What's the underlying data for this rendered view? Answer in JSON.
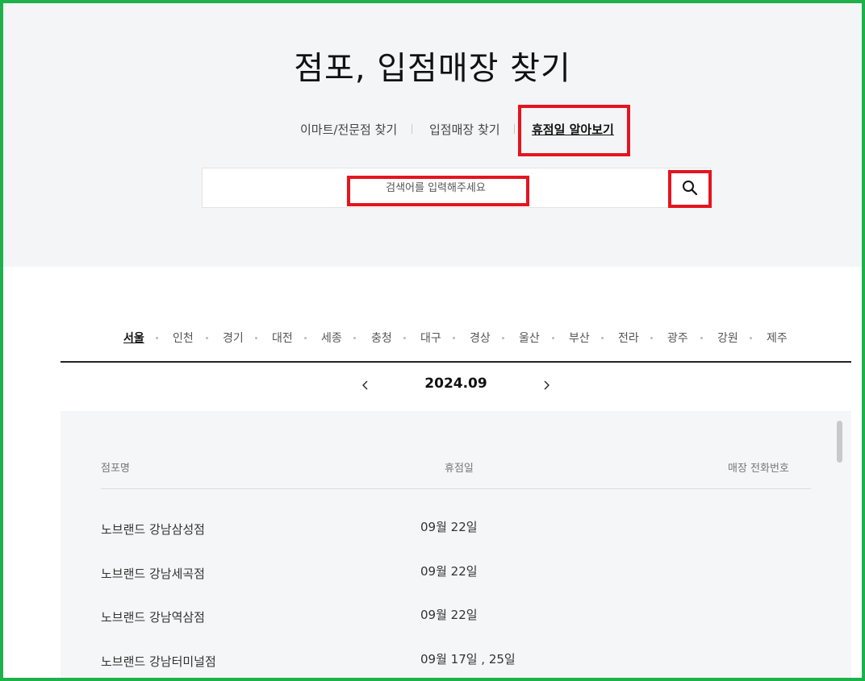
{
  "title": "점포, 입점매장 찾기",
  "tabs": [
    {
      "label": "이마트/전문점 찾기",
      "active": false
    },
    {
      "label": "입점매장 찾기",
      "active": false
    },
    {
      "label": "휴점일 알아보기",
      "active": true
    }
  ],
  "search": {
    "placeholder": "검색어를 입력해주세요",
    "value": "",
    "button_icon": "search-icon"
  },
  "regions": [
    "서울",
    "인천",
    "경기",
    "대전",
    "세종",
    "충청",
    "대구",
    "경상",
    "울산",
    "부산",
    "전라",
    "광주",
    "강원",
    "제주"
  ],
  "active_region": "서울",
  "month": {
    "label": "2024.09",
    "prev_icon": "chevron-left-icon",
    "next_icon": "chevron-right-icon"
  },
  "table": {
    "headers": [
      "점포명",
      "휴점일",
      "매장 전화번호"
    ],
    "rows": [
      {
        "name": "노브랜드 강남삼성점",
        "closed": "09월 22일",
        "phone": ""
      },
      {
        "name": "노브랜드 강남세곡점",
        "closed": "09월 22일",
        "phone": ""
      },
      {
        "name": "노브랜드 강남역삼점",
        "closed": "09월 22일",
        "phone": ""
      },
      {
        "name": "노브랜드 강남터미널점",
        "closed": "09월 17일 , 25일",
        "phone": ""
      }
    ]
  },
  "colors": {
    "frame": "#1db14b",
    "highlight": "#e5141f",
    "hero_bg": "#f4f5f6",
    "table_bg": "#f5f6f7"
  }
}
